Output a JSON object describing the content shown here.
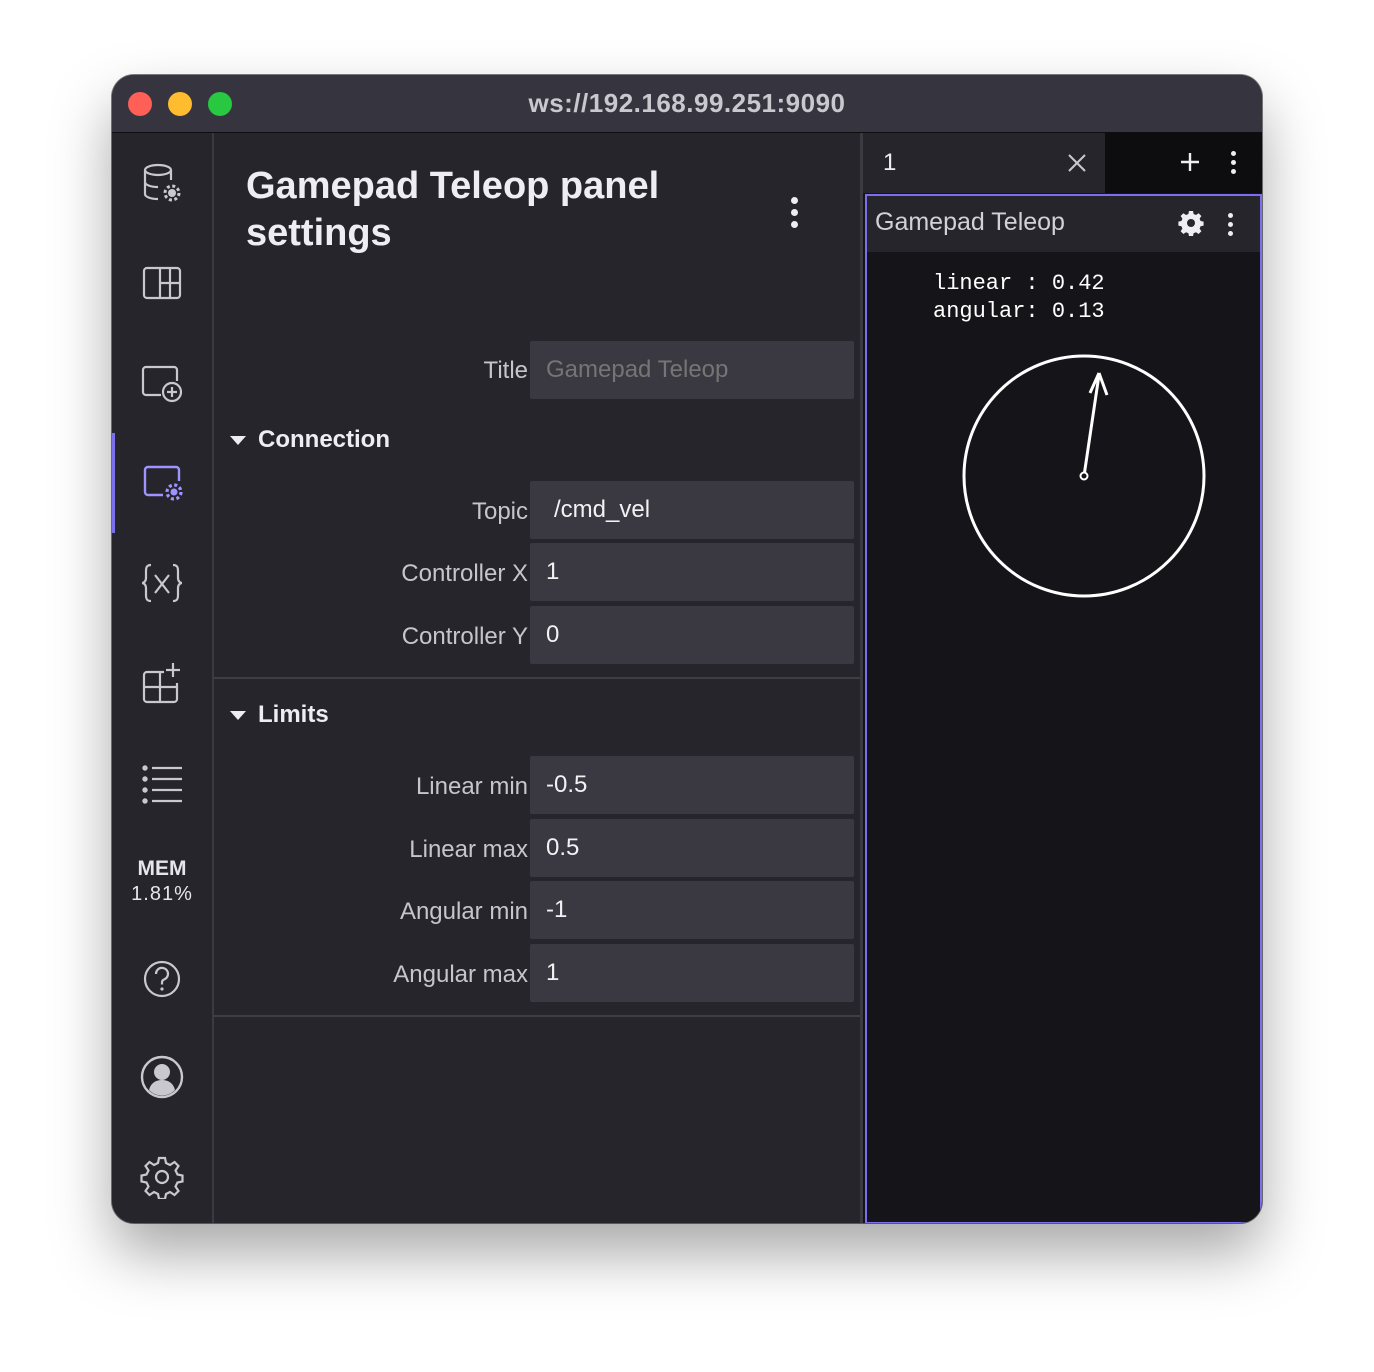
{
  "window": {
    "title": "ws://192.168.99.251:9090"
  },
  "sidebar": {
    "items": [
      {
        "icon": "data-source-settings-icon"
      },
      {
        "icon": "layout-icon"
      },
      {
        "icon": "add-panel-icon"
      },
      {
        "icon": "panel-settings-icon",
        "active": true
      },
      {
        "icon": "variables-icon"
      },
      {
        "icon": "extensions-icon"
      },
      {
        "icon": "topics-list-icon"
      }
    ],
    "mem_label": "MEM",
    "mem_value": "1.81%",
    "bottom": [
      {
        "icon": "help-icon"
      },
      {
        "icon": "account-icon"
      },
      {
        "icon": "settings-gear-icon"
      }
    ]
  },
  "settings": {
    "title": "Gamepad Teleop panel settings",
    "title_label": "Title",
    "title_placeholder": "Gamepad Teleop",
    "connection": {
      "heading": "Connection",
      "fields": [
        {
          "label": "Topic",
          "value": "/cmd_vel"
        },
        {
          "label": "Controller X",
          "value": "1"
        },
        {
          "label": "Controller Y",
          "value": "0"
        }
      ]
    },
    "limits": {
      "heading": "Limits",
      "fields": [
        {
          "label": "Linear min",
          "value": "-0.5"
        },
        {
          "label": "Linear max",
          "value": "0.5"
        },
        {
          "label": "Angular min",
          "value": "-1"
        },
        {
          "label": "Angular max",
          "value": "1"
        }
      ]
    }
  },
  "layout_tab": {
    "name": "1"
  },
  "panel": {
    "title": "Gamepad Teleop",
    "readout": {
      "linear_label": "linear :",
      "linear_value": "0.42",
      "angular_label": "angular:",
      "angular_value": "0.13"
    }
  },
  "colors": {
    "accent": "#7b6ff0",
    "background": "#26252b",
    "panel_bg": "#151419",
    "field_bg": "#3a3941"
  }
}
